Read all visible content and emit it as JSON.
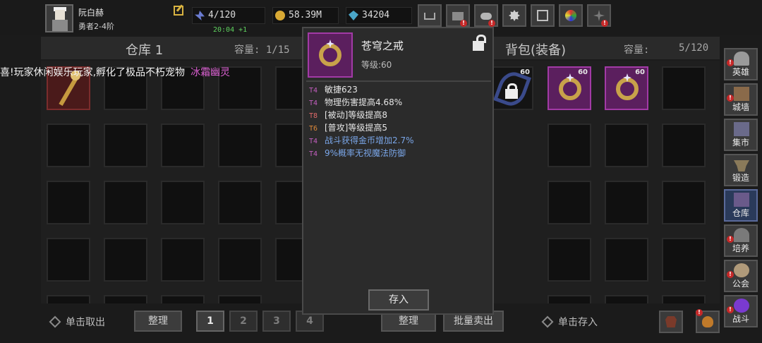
{
  "player": {
    "name": "阮白赫",
    "rank": "勇者2-4阶"
  },
  "resources": {
    "energy": "4/120",
    "energy_timer": "20:04 +1",
    "gold": "58.39M",
    "gems": "34204"
  },
  "warehouse": {
    "title": "仓库 1",
    "capacity_label": "容量: 1/15"
  },
  "bag": {
    "title": "背包(装备)",
    "capacity_label": "容量:",
    "capacity_value": "5/120"
  },
  "announcement": {
    "text": "喜!玩家休闲娱乐玩家,孵化了极品不朽宠物",
    "pet": "冰霜幽灵"
  },
  "bag_items": [
    {
      "level": "60"
    },
    {
      "level": "60"
    },
    {
      "level": "60"
    }
  ],
  "tooltip": {
    "name": "苍穹之戒",
    "level": "等级:60",
    "stats": [
      {
        "tier": "T4",
        "text": "敏捷623"
      },
      {
        "tier": "T4",
        "text": "物理伤害提高4.68%"
      },
      {
        "tier": "T8",
        "text": "[被动]等级提高8"
      },
      {
        "tier": "T6",
        "text": "[普攻]等级提高5"
      },
      {
        "tier": "T4",
        "text": "战斗获得金币增加2.7%"
      },
      {
        "tier": "T4",
        "text": "9%概率无视魔法防御"
      }
    ],
    "deposit_label": "存入"
  },
  "bottom": {
    "take_out_hint": "单击取出",
    "sort_label": "整理",
    "pages": [
      "1",
      "2",
      "3",
      "4"
    ],
    "sort_label_right": "整理",
    "bulk_sell_label": "批量卖出",
    "deposit_hint": "单击存入"
  },
  "sidebar": [
    {
      "label": "英雄",
      "icon": "helmet-icon"
    },
    {
      "label": "城墙",
      "icon": "wall-icon"
    },
    {
      "label": "集市",
      "icon": "market-icon"
    },
    {
      "label": "锻造",
      "icon": "anvil-icon"
    },
    {
      "label": "仓库",
      "icon": "chest-icon"
    },
    {
      "label": "培养",
      "icon": "cultivate-icon"
    },
    {
      "label": "公会",
      "icon": "guild-icon"
    },
    {
      "label": "战斗",
      "icon": "portal-icon"
    }
  ],
  "top_buttons": [
    "cart-icon",
    "mail-icon",
    "gamepad-icon",
    "gear-icon",
    "gift-icon",
    "wheel-icon",
    "sparkle-icon"
  ],
  "colors": {
    "item_red": "#4a1a1a",
    "item_purple": "#5b1f5e",
    "pet_name": "#d95fd0",
    "timer_green": "#5ed05e"
  }
}
